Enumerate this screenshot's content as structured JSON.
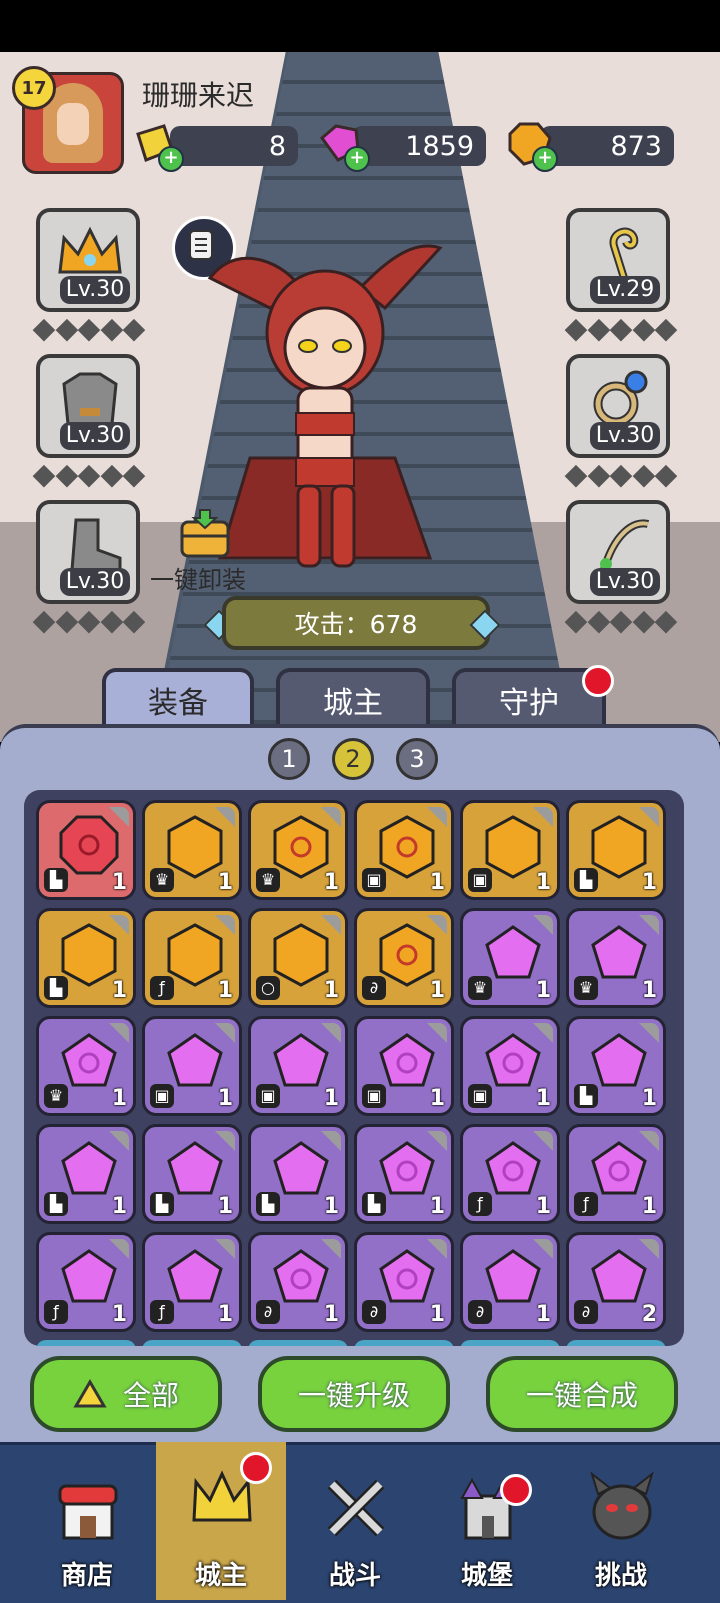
{
  "player": {
    "name": "珊珊来迟",
    "level": "17"
  },
  "resources": [
    {
      "name": "gold-bar",
      "value": "8",
      "color": "#f2d23a"
    },
    {
      "name": "gem",
      "value": "1859",
      "color": "#e14ed1"
    },
    {
      "name": "coin",
      "value": "873",
      "color": "#f0a623"
    }
  ],
  "equipment_left": [
    {
      "name": "crown",
      "level": "Lv.30"
    },
    {
      "name": "armor",
      "level": "Lv.30"
    },
    {
      "name": "boots",
      "level": "Lv.30"
    }
  ],
  "equipment_right": [
    {
      "name": "staff",
      "level": "Lv.29"
    },
    {
      "name": "ring",
      "level": "Lv.30"
    },
    {
      "name": "amulet",
      "level": "Lv.30"
    }
  ],
  "unequip_label": "一键卸装",
  "attack_label": "攻击：678",
  "tabs": [
    "装备",
    "城主",
    "守护"
  ],
  "pages": [
    "1",
    "2",
    "3"
  ],
  "inventory": [
    {
      "rarity": "red",
      "type": "boot",
      "count": "1",
      "swirl": true
    },
    {
      "rarity": "gold",
      "type": "crown",
      "count": "1",
      "swirl": false
    },
    {
      "rarity": "gold",
      "type": "crown",
      "count": "1",
      "swirl": true
    },
    {
      "rarity": "gold",
      "type": "armor",
      "count": "1",
      "swirl": true
    },
    {
      "rarity": "gold",
      "type": "armor",
      "count": "1",
      "swirl": false
    },
    {
      "rarity": "gold",
      "type": "boot",
      "count": "1",
      "swirl": false
    },
    {
      "rarity": "gold",
      "type": "boot",
      "count": "1",
      "swirl": false
    },
    {
      "rarity": "gold",
      "type": "staff",
      "count": "1",
      "swirl": false
    },
    {
      "rarity": "gold",
      "type": "ring",
      "count": "1",
      "swirl": false
    },
    {
      "rarity": "gold",
      "type": "amulet",
      "count": "1",
      "swirl": true
    },
    {
      "rarity": "purple",
      "type": "crown",
      "count": "1",
      "swirl": false
    },
    {
      "rarity": "purple",
      "type": "crown",
      "count": "1",
      "swirl": false
    },
    {
      "rarity": "purple",
      "type": "crown",
      "count": "1",
      "swirl": true
    },
    {
      "rarity": "purple",
      "type": "armor",
      "count": "1",
      "swirl": false
    },
    {
      "rarity": "purple",
      "type": "armor",
      "count": "1",
      "swirl": false
    },
    {
      "rarity": "purple",
      "type": "armor",
      "count": "1",
      "swirl": true
    },
    {
      "rarity": "purple",
      "type": "armor",
      "count": "1",
      "swirl": true
    },
    {
      "rarity": "purple",
      "type": "boot",
      "count": "1",
      "swirl": false
    },
    {
      "rarity": "purple",
      "type": "boot",
      "count": "1",
      "swirl": false
    },
    {
      "rarity": "purple",
      "type": "boot",
      "count": "1",
      "swirl": false
    },
    {
      "rarity": "purple",
      "type": "boot",
      "count": "1",
      "swirl": false
    },
    {
      "rarity": "purple",
      "type": "boot",
      "count": "1",
      "swirl": true
    },
    {
      "rarity": "purple",
      "type": "staff",
      "count": "1",
      "swirl": true
    },
    {
      "rarity": "purple",
      "type": "staff",
      "count": "1",
      "swirl": true
    },
    {
      "rarity": "purple",
      "type": "staff",
      "count": "1",
      "swirl": false
    },
    {
      "rarity": "purple",
      "type": "staff",
      "count": "1",
      "swirl": false
    },
    {
      "rarity": "purple",
      "type": "amulet",
      "count": "1",
      "swirl": true
    },
    {
      "rarity": "purple",
      "type": "amulet",
      "count": "1",
      "swirl": true
    },
    {
      "rarity": "purple",
      "type": "amulet",
      "count": "1",
      "swirl": false
    },
    {
      "rarity": "purple",
      "type": "amulet",
      "count": "2",
      "swirl": false
    }
  ],
  "actions": [
    "全部",
    "一键升级",
    "一键合成"
  ],
  "nav": [
    {
      "label": "商店",
      "icon": "shop-icon"
    },
    {
      "label": "城主",
      "icon": "crown-icon"
    },
    {
      "label": "战斗",
      "icon": "swords-icon"
    },
    {
      "label": "城堡",
      "icon": "castle-icon"
    },
    {
      "label": "挑战",
      "icon": "monster-icon"
    }
  ]
}
